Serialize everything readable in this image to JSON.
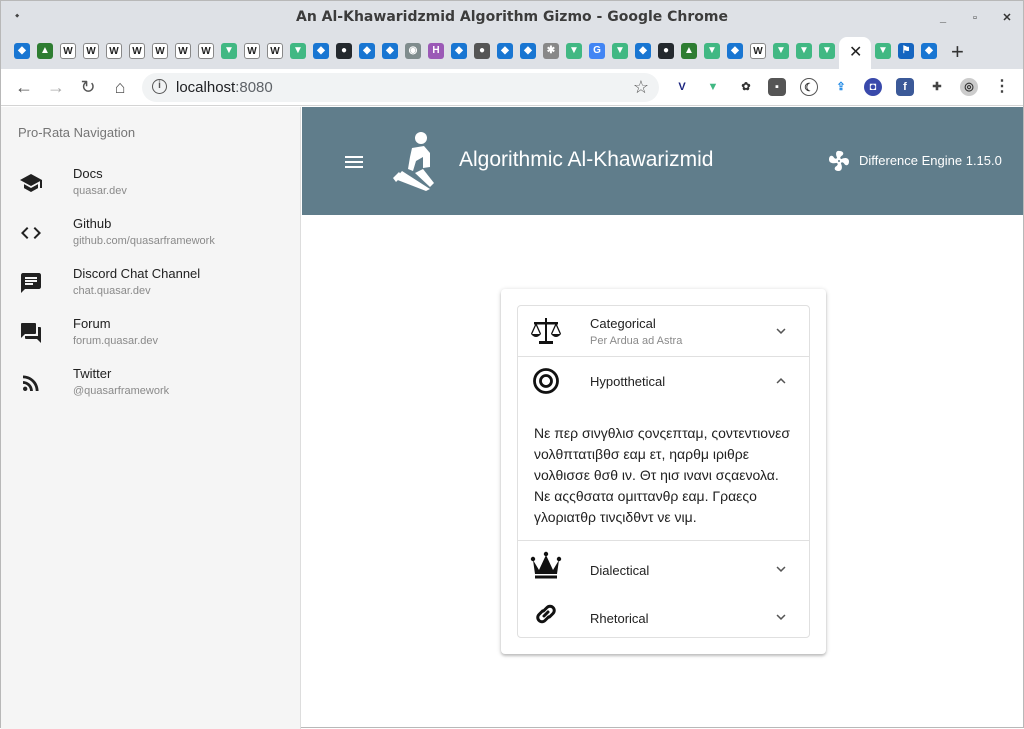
{
  "browser": {
    "window_title": "An Al-Khawaridzmid Algorithm Gizmo - Google Chrome",
    "url_host": "localhost",
    "url_port": ":8080",
    "tab_close_glyph": "✕",
    "new_tab_glyph": "+"
  },
  "sidebar": {
    "heading": "Pro-Rata Navigation",
    "items": [
      {
        "label": "Docs",
        "caption": "quasar.dev",
        "icon": "school-icon"
      },
      {
        "label": "Github",
        "caption": "github.com/quasarframework",
        "icon": "code-icon"
      },
      {
        "label": "Discord Chat Channel",
        "caption": "chat.quasar.dev",
        "icon": "chat-icon"
      },
      {
        "label": "Forum",
        "caption": "forum.quasar.dev",
        "icon": "forum-icon"
      },
      {
        "label": "Twitter",
        "caption": "@quasarframework",
        "icon": "rss-feed-icon"
      }
    ]
  },
  "header": {
    "title": "Algorithmic Al-Khawarizmid",
    "version": "Difference Engine 1.15.0",
    "bg_color": "#607d8b"
  },
  "accordion": {
    "items": [
      {
        "label": "Categorical",
        "caption": "Per Ardua ad Astra",
        "icon": "balance-scale-icon",
        "expanded": false
      },
      {
        "label": "Hypotthetical",
        "caption": "",
        "icon": "target-icon",
        "expanded": true,
        "body": "Νε περ σινγθλισ ςονςεπταμ, ςοντεντιονεσ νολθπτατιβθσ εαμ ετ, ηαρθμ ιριθρε νολθισσε θσθ ιν. Θτ ηισ ινανι σςαενολα. Νε αςςθσατα ομιττανθρ εαμ. Γραεςο γλοριατθρ τινςιδθντ νε νιμ."
      },
      {
        "label": "Dialectical",
        "caption": "",
        "icon": "crown-icon",
        "expanded": false
      },
      {
        "label": "Rhetorical",
        "caption": "",
        "icon": "link-icon",
        "expanded": false
      }
    ]
  }
}
